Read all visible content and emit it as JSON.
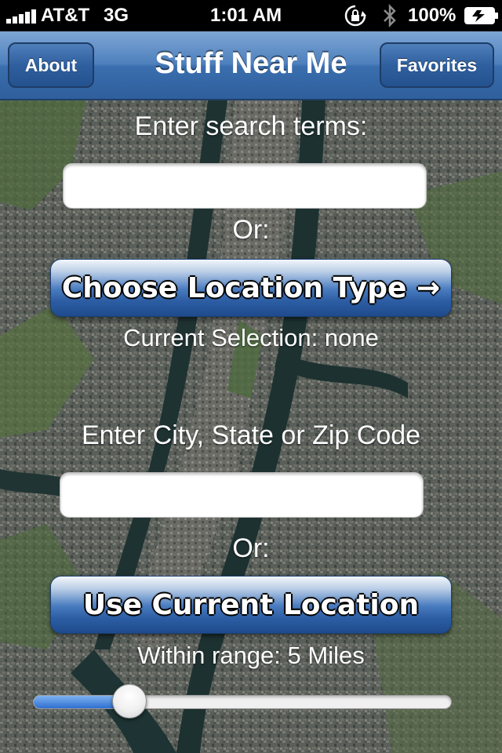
{
  "status_bar": {
    "carrier": "AT&T",
    "network": "3G",
    "time": "1:01 AM",
    "battery_percent": "100%",
    "icons": [
      "signal-bars-icon",
      "rotation-lock-icon",
      "bluetooth-icon",
      "battery-charging-icon"
    ]
  },
  "nav": {
    "title": "Stuff Near Me",
    "left_button": "About",
    "right_button": "Favorites"
  },
  "search": {
    "label": "Enter search terms:",
    "value": "",
    "or_label": "Or:"
  },
  "location_type": {
    "button_label": "Choose Location Type →",
    "current_selection": "Current Selection: none"
  },
  "city": {
    "label": "Enter City, State or Zip Code",
    "value": "",
    "or_label": "Or:"
  },
  "current_location": {
    "button_label": "Use Current Location"
  },
  "range": {
    "label": "Within range: 5 Miles",
    "slider_fraction": 0.23
  },
  "colors": {
    "nav_blue": "#3a6eae",
    "button_blue": "#2c5da3",
    "slider_fill": "#2f6fd0"
  }
}
